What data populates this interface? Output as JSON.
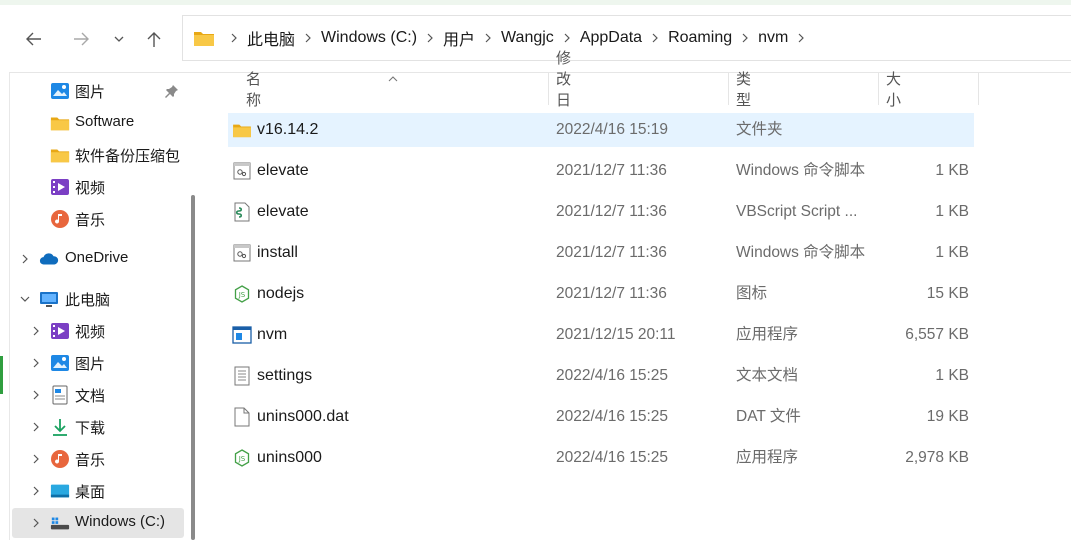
{
  "address": {
    "crumbs": [
      "此电脑",
      "Windows (C:)",
      "用户",
      "Wangjc",
      "AppData",
      "Roaming",
      "nvm"
    ]
  },
  "sidebar": {
    "items": [
      {
        "label": "图片",
        "icon": "pictures-icon"
      },
      {
        "label": "Software",
        "icon": "folder-icon"
      },
      {
        "label": "软件备份压缩包",
        "icon": "folder-icon"
      },
      {
        "label": "视频",
        "icon": "videos-icon"
      },
      {
        "label": "音乐",
        "icon": "music-icon"
      },
      {
        "label": "OneDrive",
        "icon": "onedrive-icon"
      },
      {
        "label": "此电脑",
        "icon": "this-pc-icon"
      },
      {
        "label": "视频",
        "icon": "videos-icon"
      },
      {
        "label": "图片",
        "icon": "pictures-icon"
      },
      {
        "label": "文档",
        "icon": "documents-icon"
      },
      {
        "label": "下载",
        "icon": "downloads-icon"
      },
      {
        "label": "音乐",
        "icon": "music-icon"
      },
      {
        "label": "桌面",
        "icon": "desktop-icon"
      },
      {
        "label": "Windows (C:)",
        "icon": "drive-icon"
      }
    ]
  },
  "columns": {
    "name": "名称",
    "date": "修改日期",
    "type": "类型",
    "size": "大小"
  },
  "files": [
    {
      "name": "v16.14.2",
      "date": "2022/4/16 15:19",
      "type": "文件夹",
      "size": "",
      "icon": "folder-icon"
    },
    {
      "name": "elevate",
      "date": "2021/12/7 11:36",
      "type": "Windows 命令脚本",
      "size": "1 KB",
      "icon": "cmd-script-icon"
    },
    {
      "name": "elevate",
      "date": "2021/12/7 11:36",
      "type": "VBScript Script ...",
      "size": "1 KB",
      "icon": "vbscript-icon"
    },
    {
      "name": "install",
      "date": "2021/12/7 11:36",
      "type": "Windows 命令脚本",
      "size": "1 KB",
      "icon": "cmd-script-icon"
    },
    {
      "name": "nodejs",
      "date": "2021/12/7 11:36",
      "type": "图标",
      "size": "15 KB",
      "icon": "nodejs-icon"
    },
    {
      "name": "nvm",
      "date": "2021/12/15 20:11",
      "type": "应用程序",
      "size": "6,557 KB",
      "icon": "application-icon"
    },
    {
      "name": "settings",
      "date": "2022/4/16 15:25",
      "type": "文本文档",
      "size": "1 KB",
      "icon": "text-file-icon"
    },
    {
      "name": "unins000.dat",
      "date": "2022/4/16 15:25",
      "type": "DAT 文件",
      "size": "19 KB",
      "icon": "blank-file-icon"
    },
    {
      "name": "unins000",
      "date": "2022/4/16 15:25",
      "type": "应用程序",
      "size": "2,978 KB",
      "icon": "nodejs-icon"
    }
  ],
  "colors": {
    "folder": "#f6c343",
    "selection": "#e5f3ff",
    "accent": "#0f6cbd"
  }
}
